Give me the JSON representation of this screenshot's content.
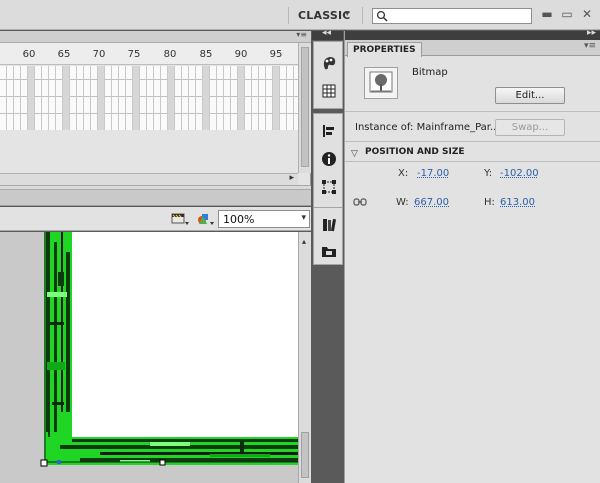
{
  "topbar": {
    "workspace": "CLASSIC",
    "workspace_caret": "▾",
    "search_value": "",
    "window_buttons": [
      "▬",
      "▭",
      "✕"
    ]
  },
  "timeline": {
    "panel_menu": "▾≡",
    "ruler_numbers": [
      "60",
      "65",
      "70",
      "75",
      "80",
      "85",
      "90",
      "95"
    ],
    "hscroll_arrow": "▸"
  },
  "stage_toolbar": {
    "zoom_value": "100%",
    "zoom_caret": "▾"
  },
  "stage": {
    "vscroll_arrow": "▴"
  },
  "dock": {
    "collapse": "◂◂",
    "icons": [
      "color-swatch-icon",
      "grid-icon",
      "align-icon",
      "info-icon",
      "transform-icon",
      "library-books-icon",
      "project-icon"
    ]
  },
  "properties": {
    "collapse": "▸▸",
    "tab_label": "PROPERTIES",
    "tab_menu": "▾≡",
    "symbol_type": "Bitmap",
    "edit_button": "Edit...",
    "instance_label": "Instance of:",
    "instance_name": "Mainframe_Par...",
    "swap_button": "Swap...",
    "section_arrow": "▽",
    "section_title": "POSITION AND SIZE",
    "x_label": "X:",
    "x_value": "-17.00",
    "y_label": "Y:",
    "y_value": "-102.00",
    "w_label": "W:",
    "w_value": "667.00",
    "h_label": "H:",
    "h_value": "613.00"
  },
  "colors": {
    "circuit_green": "#1fd624",
    "circuit_dark": "#0c3a0c",
    "link_blue": "#2b5fa6"
  }
}
